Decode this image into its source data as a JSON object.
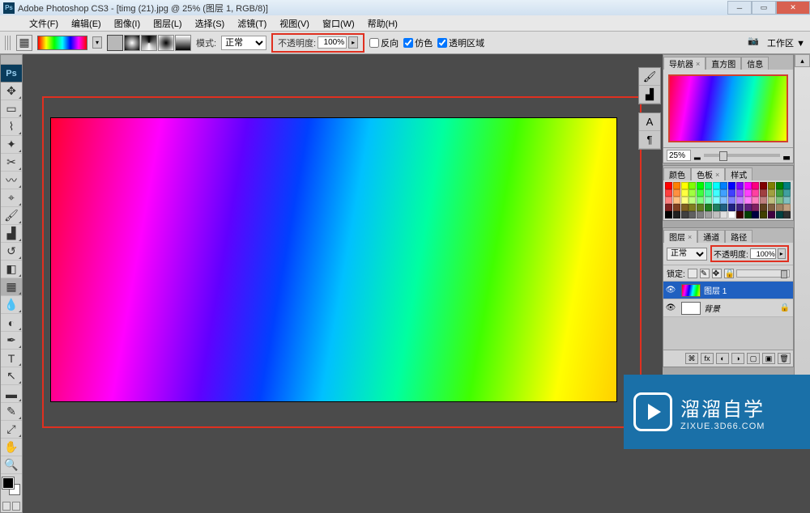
{
  "title": "Adobe Photoshop CS3 - [timg (21).jpg @ 25% (图层 1, RGB/8)]",
  "menu": [
    "文件(F)",
    "编辑(E)",
    "图像(I)",
    "图层(L)",
    "选择(S)",
    "滤镜(T)",
    "视图(V)",
    "窗口(W)",
    "帮助(H)"
  ],
  "options": {
    "mode_label": "模式:",
    "mode_value": "正常",
    "opacity_label": "不透明度:",
    "opacity_value": "100%",
    "reverse": "反向",
    "dither": "仿色",
    "transparency": "透明区域",
    "workspace": "工作区 ▼"
  },
  "navigator": {
    "tabs": [
      "导航器",
      "直方图",
      "信息"
    ],
    "zoom": "25%"
  },
  "color_panel": {
    "tabs": [
      "颜色",
      "色板",
      "样式"
    ]
  },
  "layers_panel": {
    "tabs": [
      "图层",
      "通道",
      "路径"
    ],
    "blend": "正常",
    "opacity_label": "不透明度:",
    "opacity_value": "100%",
    "lock_label": "锁定:",
    "layer1": "图层 1",
    "bg": "背景"
  },
  "watermark": {
    "title": "溜溜自学",
    "url": "ZIXUE.3D66.COM"
  },
  "swatch_colors": [
    "#ff0000",
    "#ff8000",
    "#ffff00",
    "#80ff00",
    "#00ff00",
    "#00ff80",
    "#00ffff",
    "#0080ff",
    "#0000ff",
    "#8000ff",
    "#ff00ff",
    "#ff0080",
    "#800000",
    "#808000",
    "#008000",
    "#008080",
    "#ff4040",
    "#ff9040",
    "#ffff40",
    "#a0ff40",
    "#40ff40",
    "#40ffa0",
    "#40ffff",
    "#40a0ff",
    "#4040ff",
    "#a040ff",
    "#ff40ff",
    "#ff40a0",
    "#a04040",
    "#a0a040",
    "#40a040",
    "#40a0a0",
    "#ff8080",
    "#ffc080",
    "#ffff80",
    "#c0ff80",
    "#80ff80",
    "#80ffc0",
    "#80ffff",
    "#80c0ff",
    "#8080ff",
    "#c080ff",
    "#ff80ff",
    "#ff80c0",
    "#c08080",
    "#c0c080",
    "#80c080",
    "#80c0c0",
    "#802020",
    "#804020",
    "#806020",
    "#808020",
    "#608020",
    "#208020",
    "#208060",
    "#206080",
    "#202080",
    "#402080",
    "#602080",
    "#802060",
    "#604020",
    "#806040",
    "#a08060",
    "#c0a080",
    "#000000",
    "#202020",
    "#404040",
    "#606060",
    "#808080",
    "#a0a0a0",
    "#c0c0c0",
    "#e0e0e0",
    "#ffffff",
    "#400000",
    "#004000",
    "#000040",
    "#404000",
    "#400040",
    "#004040",
    "#303030"
  ]
}
